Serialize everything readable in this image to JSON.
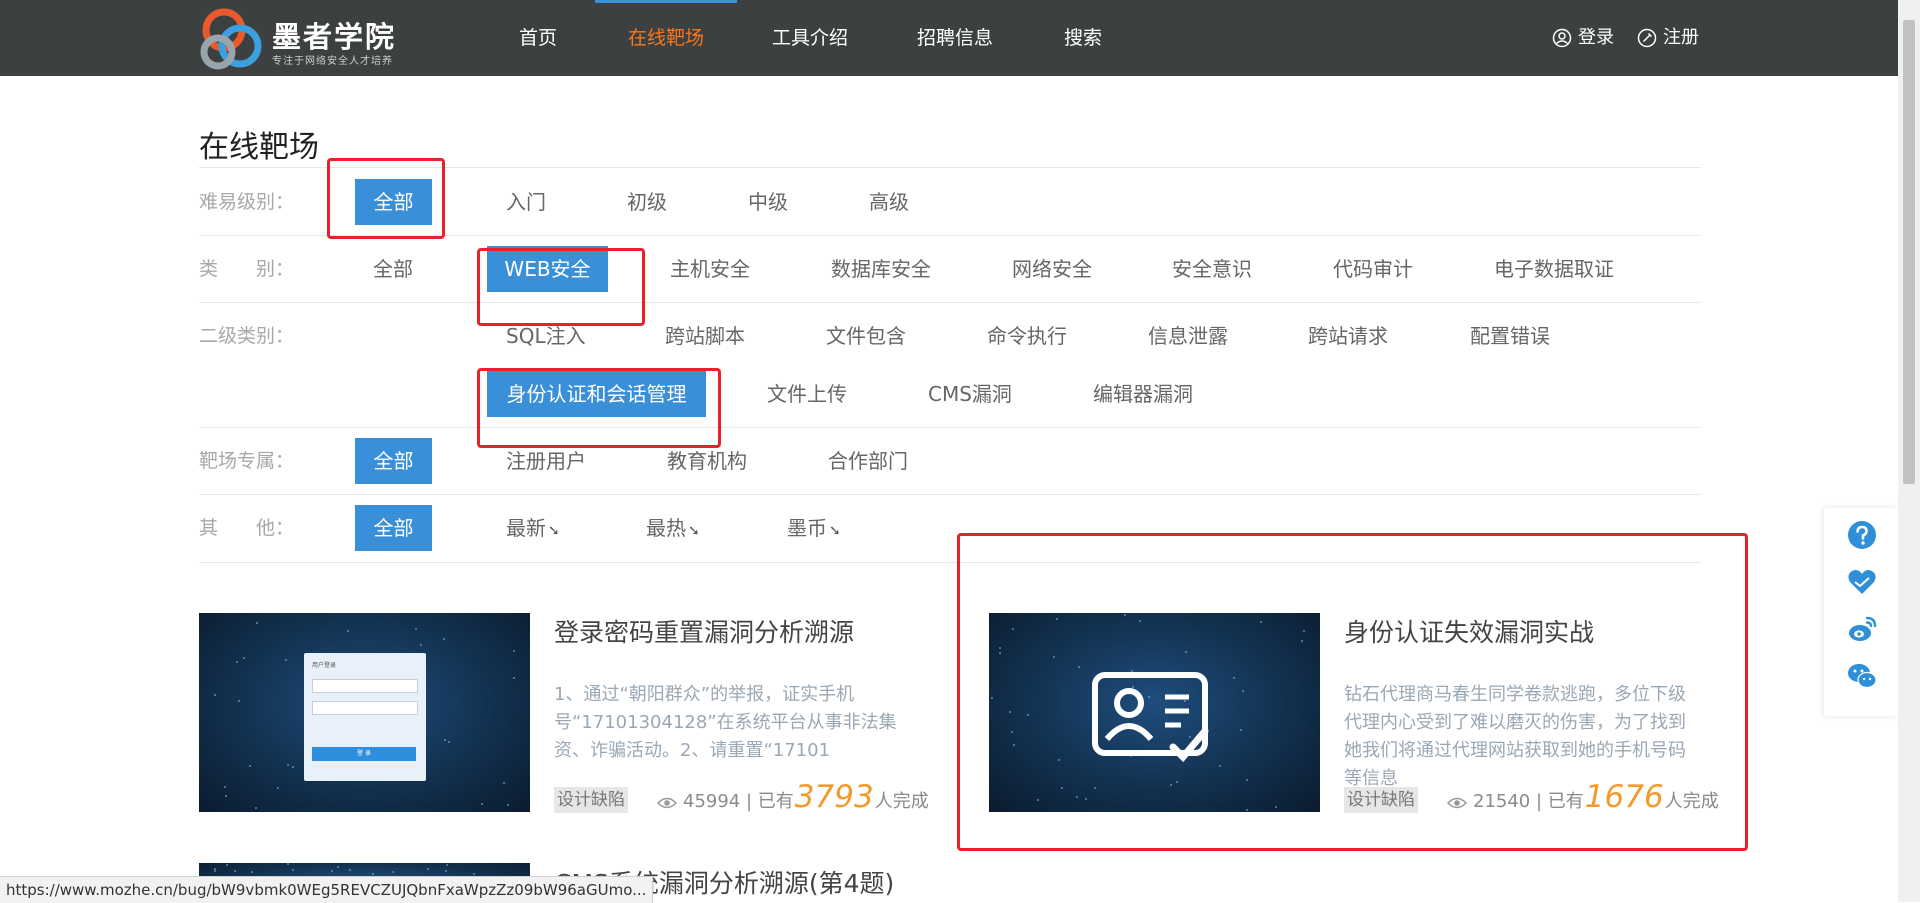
{
  "logo": {
    "title": "墨者学院",
    "subtitle": "专注于网络安全人才培养"
  },
  "nav": {
    "items": [
      "首页",
      "在线靶场",
      "工具介绍",
      "招聘信息",
      "搜索"
    ],
    "active": "在线靶场",
    "login": "登录",
    "register": "注册"
  },
  "page_title": "在线靶场",
  "filters": {
    "difficulty": {
      "label": "难易级别：",
      "options": [
        "全部",
        "入门",
        "初级",
        "中级",
        "高级"
      ],
      "selected": "全部"
    },
    "category": {
      "label": "类　　别：",
      "options": [
        "全部",
        "WEB安全",
        "主机安全",
        "数据库安全",
        "网络安全",
        "安全意识",
        "代码审计",
        "电子数据取证"
      ],
      "selected": "WEB安全"
    },
    "subcategory": {
      "label": "二级类别：",
      "options": [
        "SQL注入",
        "跨站脚本",
        "文件包含",
        "命令执行",
        "信息泄露",
        "跨站请求",
        "配置错误",
        "身份认证和会话管理",
        "文件上传",
        "CMS漏洞",
        "编辑器漏洞"
      ],
      "selected": "身份认证和会话管理"
    },
    "exclusive": {
      "label": "靶场专属：",
      "options": [
        "全部",
        "注册用户",
        "教育机构",
        "合作部门"
      ],
      "selected": "全部"
    },
    "other": {
      "label": "其　　他：",
      "options": [
        "全部",
        "最新",
        "最热",
        "墨币"
      ],
      "selected": "全部"
    }
  },
  "cards": [
    {
      "title": "登录密码重置漏洞分析溯源",
      "desc": "1、通过“朝阳群众”的举报，证实手机号“17101304128”在系统平台从事非法集资、诈骗活动。2、请重置“17101",
      "tag": "设计缺陷",
      "views": "45994",
      "done_prefix": "| 已有",
      "done_count": "3793",
      "done_suffix": "人完成",
      "thumb_login": {
        "title": "用户登录",
        "btn": "登 录"
      }
    },
    {
      "title": "身份认证失效漏洞实战",
      "desc": "钻石代理商马春生同学卷款逃跑，多位下级代理内心受到了难以磨灭的伤害，为了找到她我们将通过代理网站获取到她的手机号码等信息",
      "tag": "设计缺陷",
      "views": "21540",
      "done_prefix": "| 已有",
      "done_count": "1676",
      "done_suffix": "人完成"
    },
    {
      "title": "CMS系统漏洞分析溯源(第4题)"
    }
  ],
  "status_url": "https://www.mozhe.cn/bug/bW9vbmk0WEg5REVCZUJQbnFxaWpzZz09bW96aGUmo...",
  "colors": {
    "nav_bg": "#3c4041",
    "accent": "#3a8fd9",
    "active_nav": "#f4781e",
    "highlight": "#e8222b",
    "count": "#f39a2d"
  },
  "icons": [
    "question-icon",
    "handshake-icon",
    "weibo-icon",
    "wechat-icon",
    "eye-icon",
    "user-icon",
    "edit-icon"
  ]
}
